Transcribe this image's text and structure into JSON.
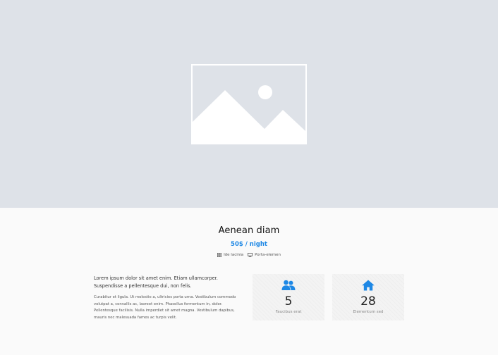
{
  "hero": {
    "image_icon": "image-placeholder-icon"
  },
  "listing": {
    "title": "Aenean diam",
    "price": "50$ / night"
  },
  "features": [
    {
      "icon": "grid-icon",
      "label": "Ide lacinia"
    },
    {
      "icon": "monitor-icon",
      "label": "Porta-elemen"
    }
  ],
  "description": {
    "lead": "Lorem ipsum dolor sit amet enim. Etiam ullamcorper. Suspendisse a pellentesque dui, non felis.",
    "body": "Curabitur et ligula. Ut molestie a, ultricies porta urna. Vestibulum commodo volutpat a, convallis ac, laoreet enim. Phasellus fermentum in, dolor. Pellentesque facilisis. Nulla imperdiet sit amet magna. Vestibulum dapibus, mauris nec malesuada fames ac turpis velit."
  },
  "stats": [
    {
      "icon": "users-icon",
      "value": "5",
      "label": "Faucibus erat"
    },
    {
      "icon": "home-icon",
      "value": "28",
      "label": "Elementum sed"
    }
  ],
  "colors": {
    "accent": "#1e88e5",
    "hero_bg": "#dee2e8",
    "page_bg": "#fafafa"
  }
}
